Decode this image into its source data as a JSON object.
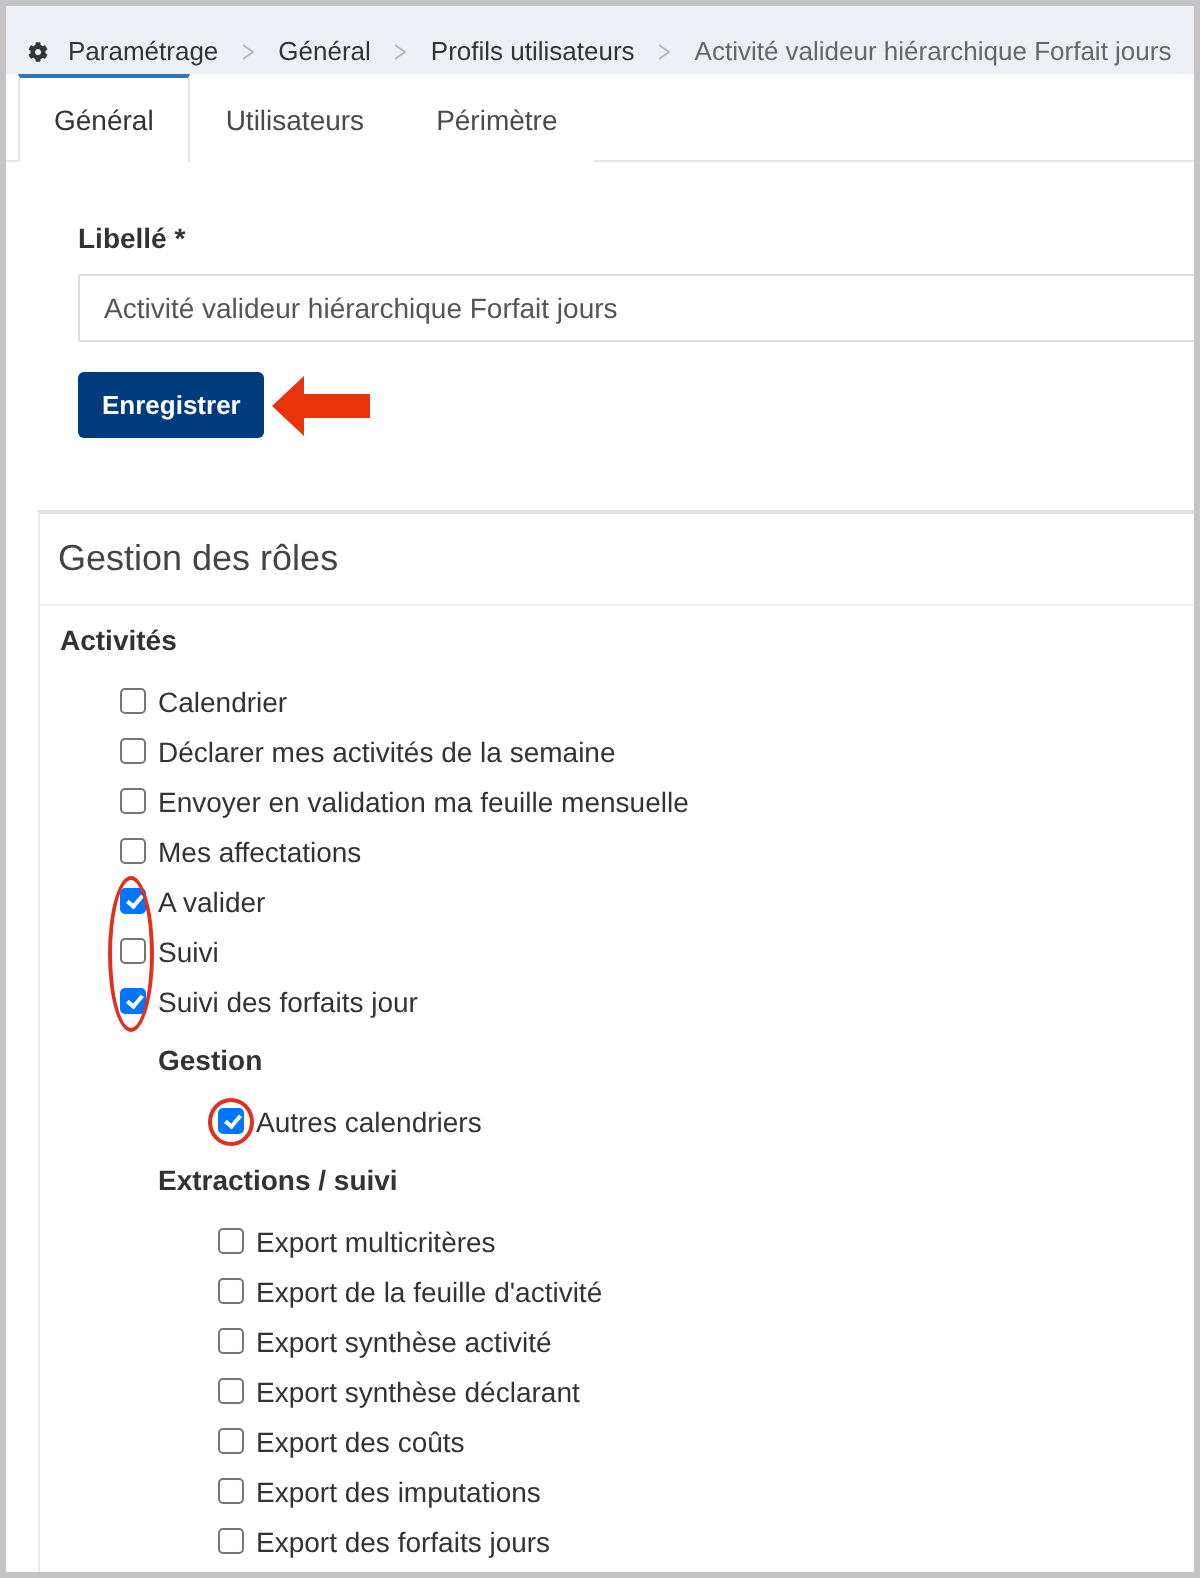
{
  "breadcrumb": {
    "items": [
      "Paramétrage",
      "Général",
      "Profils utilisateurs",
      "Activité valideur hiérarchique Forfait jours"
    ]
  },
  "tabs": [
    {
      "label": "Général",
      "selected": true
    },
    {
      "label": "Utilisateurs",
      "selected": false
    },
    {
      "label": "Périmètre",
      "selected": false
    }
  ],
  "form": {
    "field": {
      "label": "Libellé *",
      "value": "Activité valideur hiérarchique Forfait jours"
    },
    "button": {
      "label": "Enregistrer",
      "highlighted": true
    }
  },
  "roles": {
    "title": "Gestion des rôles",
    "groups": [
      {
        "title": "Activités",
        "items": [
          {
            "label": "Calendrier",
            "checked": false,
            "highlighted": false
          },
          {
            "label": "Déclarer mes activités de la semaine",
            "checked": false,
            "highlighted": false
          },
          {
            "label": "Envoyer en validation ma feuille mensuelle",
            "checked": false,
            "highlighted": false
          },
          {
            "label": "Mes affectations",
            "checked": false,
            "highlighted": false
          },
          {
            "label": "A valider",
            "checked": true,
            "highlighted": true
          },
          {
            "label": "Suivi",
            "checked": false,
            "highlighted": true
          },
          {
            "label": "Suivi des forfaits jour",
            "checked": true,
            "highlighted": true
          }
        ],
        "children": [
          {
            "title": "Gestion",
            "items": [
              {
                "label": "Autres calendriers",
                "checked": true,
                "highlighted": true
              }
            ]
          },
          {
            "title": "Extractions / suivi",
            "items": [
              {
                "label": "Export multicritères",
                "checked": false,
                "highlighted": false
              },
              {
                "label": "Export de la feuille d'activité",
                "checked": false,
                "highlighted": false
              },
              {
                "label": "Export synthèse activité",
                "checked": false,
                "highlighted": false
              },
              {
                "label": "Export synthèse déclarant",
                "checked": false,
                "highlighted": false
              },
              {
                "label": "Export des coûts",
                "checked": false,
                "highlighted": false
              },
              {
                "label": "Export des imputations",
                "checked": false,
                "highlighted": false
              },
              {
                "label": "Export des forfaits jours",
                "checked": false,
                "highlighted": false
              }
            ]
          }
        ]
      }
    ]
  }
}
